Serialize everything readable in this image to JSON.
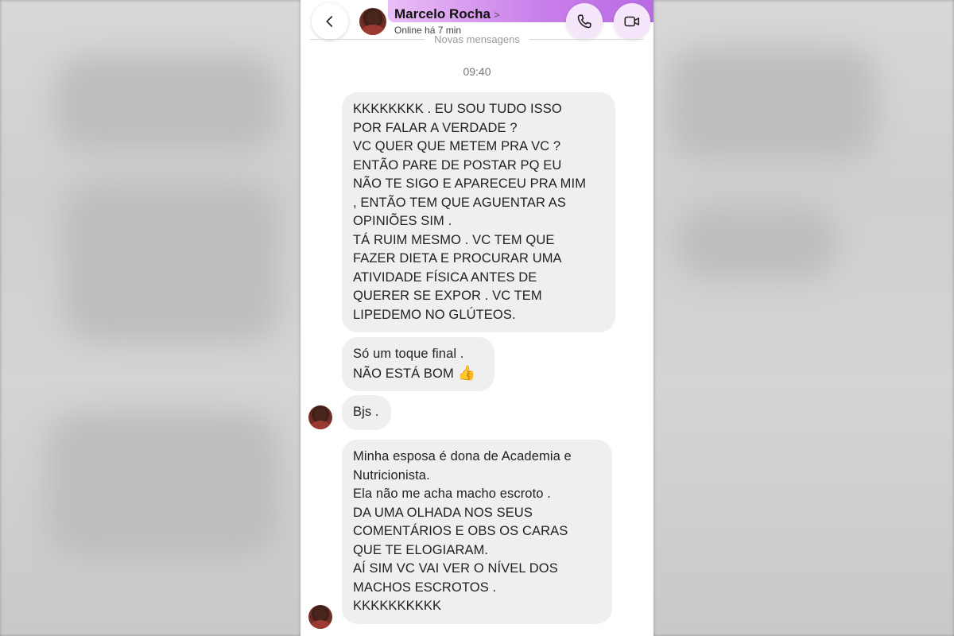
{
  "header": {
    "contact_name": "Marcelo Rocha",
    "chevron": ">",
    "status": "Online há 7 min"
  },
  "divider": {
    "new_messages": "Novas mensagens"
  },
  "timestamp": "09:40",
  "messages": [
    {
      "lines": [
        "KKKKKKKK . EU SOU TUDO ISSO",
        "POR FALAR A VERDADE ?",
        "VC QUER QUE METEM PRA VC ?",
        "ENTÃO PARE DE POSTAR PQ EU",
        "NÃO TE SIGO E APARECEU PRA MIM",
        ", ENTÃO TEM QUE AGUENTAR AS",
        "OPINIÕES SIM .",
        "TÁ RUIM MESMO . VC TEM QUE",
        "FAZER DIETA E PROCURAR UMA",
        "ATIVIDADE FÍSICA ANTES DE",
        "QUERER SE EXPOR . VC TEM",
        "LIPEDEMO NO GLÚTEOS."
      ]
    },
    {
      "lines": [
        "Só um toque final .",
        "NÃO ESTÁ BOM"
      ],
      "emoji": "👍"
    },
    {
      "lines": [
        "Bjs ."
      ]
    },
    {
      "lines": [
        "Minha esposa é dona de Academia e",
        "Nutricionista.",
        "Ela não me acha macho escroto .",
        "DA UMA OLHADA NOS SEUS",
        "COMENTÁRIOS E OBS OS CARAS",
        "QUE TE ELOGIARAM.",
        "AÍ SIM VC VAI VER O NÍVEL DOS",
        "MACHOS ESCROTOS .",
        "KKKKKKKKKK"
      ]
    }
  ],
  "icons": {
    "back": "chevron-left-icon",
    "call": "phone-icon",
    "video": "video-camera-icon",
    "avatar": "contact-avatar"
  },
  "colors": {
    "accent_purple": "#c472e8",
    "bubble_bg": "#efeff0",
    "button_bg": "#f6e6fb"
  }
}
